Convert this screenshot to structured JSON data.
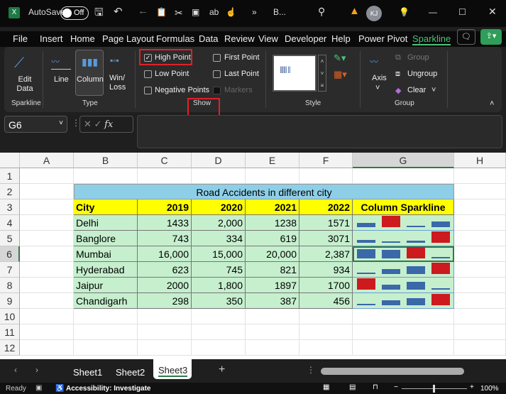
{
  "titlebar": {
    "autosave": "AutoSave",
    "toggle": "Off",
    "filename": "B...",
    "user_initials": "KJ",
    "more": "»"
  },
  "menu": [
    "File",
    "Insert",
    "Home",
    "Page Layout",
    "Formulas",
    "Data",
    "Review",
    "View",
    "Developer",
    "Help",
    "Power Pivot",
    "Sparkline"
  ],
  "ribbon": {
    "edit_data": "Edit Data",
    "types": [
      "Line",
      "Column",
      "Win/ Loss"
    ],
    "show": [
      {
        "label": "High Point",
        "checked": true
      },
      {
        "label": "Low Point",
        "checked": false
      },
      {
        "label": "Negative Points",
        "checked": false
      },
      {
        "label": "First Point",
        "checked": false
      },
      {
        "label": "Last Point",
        "checked": false
      },
      {
        "label": "Markers",
        "checked": false,
        "disabled": true
      }
    ],
    "axis": "Axis",
    "group": "Group",
    "ungroup": "Ungroup",
    "clear": "Clear",
    "groups": [
      "Sparkline",
      "Type",
      "Show",
      "Style",
      "Group"
    ]
  },
  "formula_bar": {
    "name_box": "G6",
    "fx": "fx",
    "value": ""
  },
  "columns": [
    "A",
    "B",
    "C",
    "D",
    "E",
    "F",
    "G",
    "H"
  ],
  "rows": [
    "1",
    "2",
    "3",
    "4",
    "5",
    "6",
    "7",
    "8",
    "9",
    "10",
    "11",
    "12"
  ],
  "table": {
    "title": "Road Accidents in different city",
    "headers": [
      "City",
      "2019",
      "2020",
      "2021",
      "2022",
      "Column Sparkline"
    ],
    "rows": [
      {
        "city": "Delhi",
        "vals": [
          "1433",
          "2,000",
          "1238",
          "1571"
        ],
        "nums": [
          1433,
          2000,
          1238,
          1571
        ]
      },
      {
        "city": "Banglore",
        "vals": [
          "743",
          "334",
          "619",
          "3071"
        ],
        "nums": [
          743,
          334,
          619,
          3071
        ]
      },
      {
        "city": "Mumbai",
        "vals": [
          "16,000",
          "15,000",
          "20,000",
          "2,387"
        ],
        "nums": [
          16000,
          15000,
          20000,
          2387
        ]
      },
      {
        "city": "Hyderabad",
        "vals": [
          "623",
          "745",
          "821",
          "934"
        ],
        "nums": [
          623,
          745,
          821,
          934
        ]
      },
      {
        "city": "Jaipur",
        "vals": [
          "2000",
          "1,800",
          "1897",
          "1700"
        ],
        "nums": [
          2000,
          1800,
          1897,
          1700
        ]
      },
      {
        "city": "Chandigarh",
        "vals": [
          "298",
          "350",
          "387",
          "456"
        ],
        "nums": [
          298,
          350,
          387,
          456
        ]
      }
    ]
  },
  "colors": {
    "bar": "#3a68a8",
    "high": "#cc1a1f",
    "title_bg": "#8ecfe8",
    "header_bg": "#ffff00",
    "data_bg": "#c6efce",
    "accent": "#2f9e58"
  },
  "sheets": [
    "Sheet1",
    "Sheet2",
    "Sheet3"
  ],
  "active_sheet": "Sheet3",
  "status": {
    "ready": "Ready",
    "accessibility": "Accessibility: Investigate",
    "zoom": "100%"
  }
}
